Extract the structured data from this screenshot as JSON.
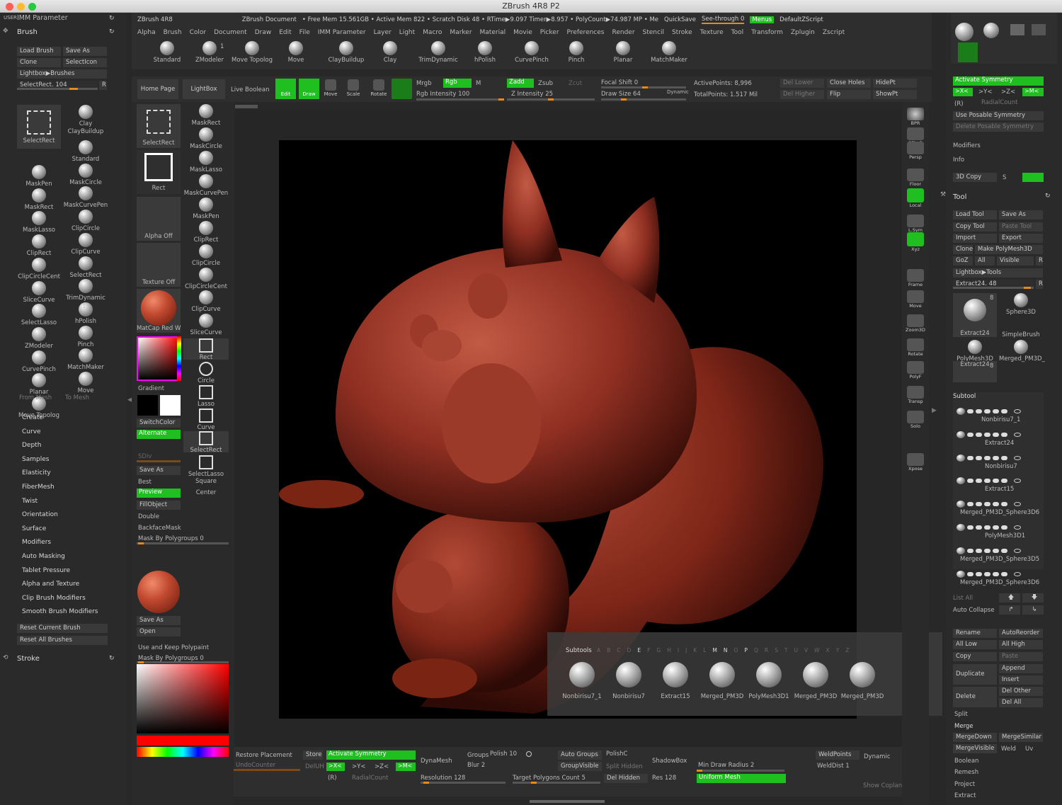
{
  "window": {
    "title": "ZBrush 4R8 P2"
  },
  "topbar": {
    "app": "ZBrush 4R8",
    "doc": "ZBrush Document",
    "stats": "• Free Mem 15.561GB • Active Mem 822 • Scratch Disk 48 • RTime▶9.097 Timer▶8.957 • PolyCount▶74.987 MP • Me",
    "quicksave": "QuickSave",
    "seethrough": "See-through  0",
    "menus": "Menus",
    "defaultzscript": "DefaultZScript"
  },
  "menubar": [
    "Alpha",
    "Brush",
    "Color",
    "Document",
    "Draw",
    "Edit",
    "File",
    "IMM Parameter",
    "Layer",
    "Light",
    "Macro",
    "Marker",
    "Material",
    "Movie",
    "Picker",
    "Preferences",
    "Render",
    "Stencil",
    "Stroke",
    "Texture",
    "Tool",
    "Transform",
    "Zplugin",
    "Zscript"
  ],
  "leftpanel": {
    "user": "USER",
    "imm": "IMM Parameter",
    "brush_title": "Brush",
    "load_brush": "Load Brush",
    "save_as": "Save As",
    "clone": "Clone",
    "selecticon": "SelectIcon",
    "lightbox": "Lightbox▶Brushes",
    "selectrect": "SelectRect. 104",
    "r": "R",
    "brushes": [
      "SelectRect",
      "Clay",
      "ClayBuildup",
      "MaskPen",
      "Standard",
      "MaskRect",
      "MaskCircle",
      "MaskLasso",
      "MaskCurvePen",
      "ClipRect",
      "ClipCircle",
      "ClipCircleCent",
      "ClipCurve",
      "SliceCurve",
      "SelectRect",
      "SelectLasso",
      "TrimDynamic",
      "ZModeler",
      "hPolish",
      "CurvePinch",
      "Pinch",
      "Planar",
      "MatchMaker",
      "Move Topolog",
      "Move"
    ],
    "zmodeler_count": "1",
    "from_mesh": "From Mesh",
    "to_mesh": "To Mesh",
    "menu": [
      "Create",
      "Curve",
      "Depth",
      "Samples",
      "Elasticity",
      "FiberMesh",
      "Twist",
      "Orientation",
      "Surface",
      "Modifiers",
      "Auto Masking",
      "Tablet Pressure",
      "Alpha and Texture",
      "Clip Brush Modifiers",
      "Smooth Brush Modifiers"
    ],
    "reset_current": "Reset Current Brush",
    "reset_all": "Reset All Brushes",
    "stroke": "Stroke"
  },
  "shelf": {
    "items": [
      "Standard",
      "ZModeler",
      "Move Topolog",
      "Move",
      "ClayBuildup",
      "Clay",
      "TrimDynamic",
      "hPolish",
      "CurvePinch",
      "Pinch",
      "Planar",
      "MatchMaker"
    ],
    "zmodeler_count": "1"
  },
  "toolbar": {
    "home": "Home Page",
    "lightbox": "LightBox",
    "liveboolean": "Live Boolean",
    "edit": "Edit",
    "draw": "Draw",
    "move": "Move",
    "scale": "Scale",
    "rotate": "Rotate",
    "mrgb": "Mrgb",
    "rgb": "Rgb",
    "m": "M",
    "rgbint": "Rgb Intensity 100",
    "zadd": "Zadd",
    "zsub": "Zsub",
    "zcut": "Zcut",
    "zint": "Z Intensity 25",
    "focal": "Focal Shift 0",
    "drawsize": "Draw Size 64",
    "dynamic": "Dynamic",
    "activepoints": "ActivePoints: 8,996",
    "totalpoints": "TotalPoints: 1.517 Mil",
    "dellower": "Del Lower",
    "delhigher": "Del Higher",
    "closeholes": "Close Holes",
    "flip": "Flip",
    "hidept": "HidePt",
    "showpt": "ShowPt"
  },
  "leftcol2": {
    "selectrect": "SelectRect",
    "rect": "Rect",
    "alpha_off": "Alpha Off",
    "texture_off": "Texture Off",
    "matcap": "MatCap Red W",
    "gradient": "Gradient",
    "switchcolor": "SwitchColor",
    "alternate": "Alternate",
    "sdiv": "SDiv",
    "saveas": "Save As",
    "best": "Best",
    "preview": "Preview",
    "fillobject": "FillObject",
    "double": "Double",
    "backfacemask": "BackfaceMask",
    "maskbypoly": "Mask By Polygroups  0",
    "saveas2": "Save As",
    "open": "Open",
    "usekeep": "Use and Keep Polypaint",
    "maskbypoly2": "Mask By Polygroups  0"
  },
  "leftcol3": [
    "MaskRect",
    "MaskCircle",
    "MaskLasso",
    "MaskCurvePen",
    "MaskPen",
    "ClipRect",
    "ClipCircle",
    "ClipCircleCent",
    "ClipCurve",
    "SliceCurve",
    "Rect",
    "Circle",
    "Lasso",
    "Curve",
    "SelectRect",
    "SelectLasso",
    "Square",
    "Center"
  ],
  "righttools": [
    "BPR",
    "SPix 3",
    "Persp",
    "Floor",
    "Local",
    "L.Sym",
    "Xyz",
    "Frame",
    "Move",
    "Zoom3D",
    "Rotate",
    "PolyF",
    "Transp",
    "Solo",
    "Xpose"
  ],
  "rightpanel": {
    "activate_sym": "Activate Symmetry",
    "xp": ">X<",
    "yp": ">Y<",
    "zp": ">Z<",
    "mp": ">M<",
    "r": "(R)",
    "radial": "RadialCount",
    "useposable": "Use Posable Symmetry",
    "deleteposable": "Delete Posable Symmetry",
    "modifiers": "Modifiers",
    "info": "Info",
    "copy3d": "3D Copy",
    "s": "S",
    "tool": "Tool",
    "loadtool": "Load Tool",
    "saveas": "Save As",
    "copytool": "Copy Tool",
    "pastetool": "Paste Tool",
    "import": "Import",
    "export": "Export",
    "clone": "Clone",
    "makepoly": "Make PolyMesh3D",
    "goz": "GoZ",
    "all": "All",
    "visible": "Visible",
    "rr": "R",
    "lightboxtools": "Lightbox▶Tools",
    "extract": "Extract24. 48",
    "tools": [
      "Extract24",
      "Sphere3D",
      "SimpleBrush",
      "PolyMesh3D",
      "Merged_PM3D_",
      "Extract24"
    ],
    "count8": "8",
    "subtool": "Subtool",
    "subtools": [
      "Nonbirisu7_1",
      "Extract24",
      "Nonbirisu7",
      "Extract15",
      "Merged_PM3D_Sphere3D6",
      "PolyMesh3D1",
      "Merged_PM3D_Sphere3D5",
      "Merged_PM3D_Sphere3D6"
    ],
    "listall": "List All",
    "autocollapse": "Auto Collapse",
    "rename": "Rename",
    "autoreorder": "AutoReorder",
    "alllow": "All Low",
    "allhigh": "All High",
    "copy": "Copy",
    "paste": "Paste",
    "duplicate": "Duplicate",
    "append": "Append",
    "insert": "Insert",
    "delete": "Delete",
    "delother": "Del Other",
    "delall": "Del All",
    "split": "Split",
    "merge": "Merge",
    "mergedown": "MergeDown",
    "mergesimilar": "MergeSimilar",
    "mergevisible": "MergeVisible",
    "weld": "Weld",
    "uv": "Uv",
    "boolean": "Boolean",
    "remesh": "Remesh",
    "project": "Project",
    "extract2": "Extract"
  },
  "subtoolbar": {
    "title": "Subtools",
    "letters": [
      "A",
      "B",
      "C",
      "D",
      "E",
      "F",
      "G",
      "H",
      "I",
      "J",
      "K",
      "L",
      "M",
      "N",
      "O",
      "P",
      "Q",
      "R",
      "S",
      "T",
      "U",
      "V",
      "W",
      "X",
      "Y",
      "Z"
    ],
    "items": [
      "Nonbirisu7_1",
      "Nonbirisu7",
      "Extract15",
      "Merged_PM3D",
      "PolyMesh3D1",
      "Merged_PM3D",
      "Merged_PM3D"
    ]
  },
  "bottom": {
    "restore": "Restore Placement",
    "store": "Store",
    "activate": "Activate Symmetry",
    "undocounter": "UndoCounter",
    "deluh": "DelUH",
    "x": ">X<",
    "y": ">Y<",
    "z": ">Z<",
    "m": ">M<",
    "r": "(R)",
    "radial": "RadialCount",
    "dynamesh": "DynaMesh",
    "groups": "Groups",
    "polish": "Polish 10",
    "blur": "Blur 2",
    "resolution": "Resolution 128",
    "autogroups": "Auto Groups",
    "groupvisible": "GroupVisible",
    "target": "Target Polygons Count 5",
    "polishc": "PolishC",
    "splithidden": "Split Hidden",
    "delhidden": "Del Hidden",
    "res": "Res 128",
    "shadowbox": "ShadowBox",
    "mindraw": "Min Draw Radius 2",
    "uniform": "Uniform Mesh",
    "weldpoints": "WeldPoints",
    "welddist": "WeldDist 1",
    "dynamic": "Dynamic",
    "showcoplanar": "Show Coplan"
  },
  "colors": {
    "green": "#1fbf1f",
    "orange": "#e88a1a",
    "model": "#8f2f22"
  }
}
